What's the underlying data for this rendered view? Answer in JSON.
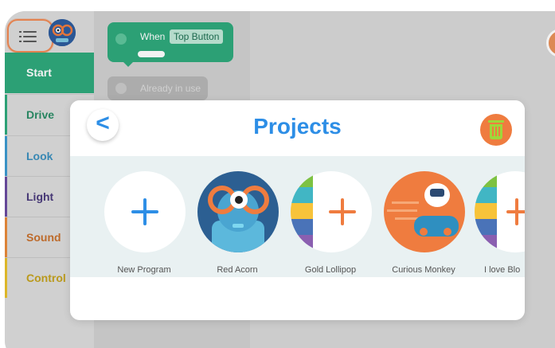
{
  "sidebar": {
    "categories": [
      {
        "label": "Start"
      },
      {
        "label": "Drive"
      },
      {
        "label": "Look"
      },
      {
        "label": "Light"
      },
      {
        "label": "Sound"
      },
      {
        "label": "Control"
      }
    ]
  },
  "palette": {
    "when_label": "When",
    "when_value": "Top Button",
    "used_label": "Already in use"
  },
  "modal": {
    "title": "Projects",
    "back_symbol": "<",
    "projects": [
      {
        "label": "New Program"
      },
      {
        "label": "Red Acorn"
      },
      {
        "label": "Gold Lollipop"
      },
      {
        "label": "Curious Monkey"
      },
      {
        "label": "I love Blo"
      }
    ]
  },
  "icons": {
    "menu": "list-icon",
    "avatar": "robot-avatar-icon",
    "back": "chevron-left-icon",
    "trash": "trash-icon",
    "add": "plus-icon"
  },
  "colors": {
    "accent_blue": "#2d8ee6",
    "start_green": "#2fa97c",
    "orange": "#ef7c3f",
    "trash_green": "#9ed83a"
  }
}
